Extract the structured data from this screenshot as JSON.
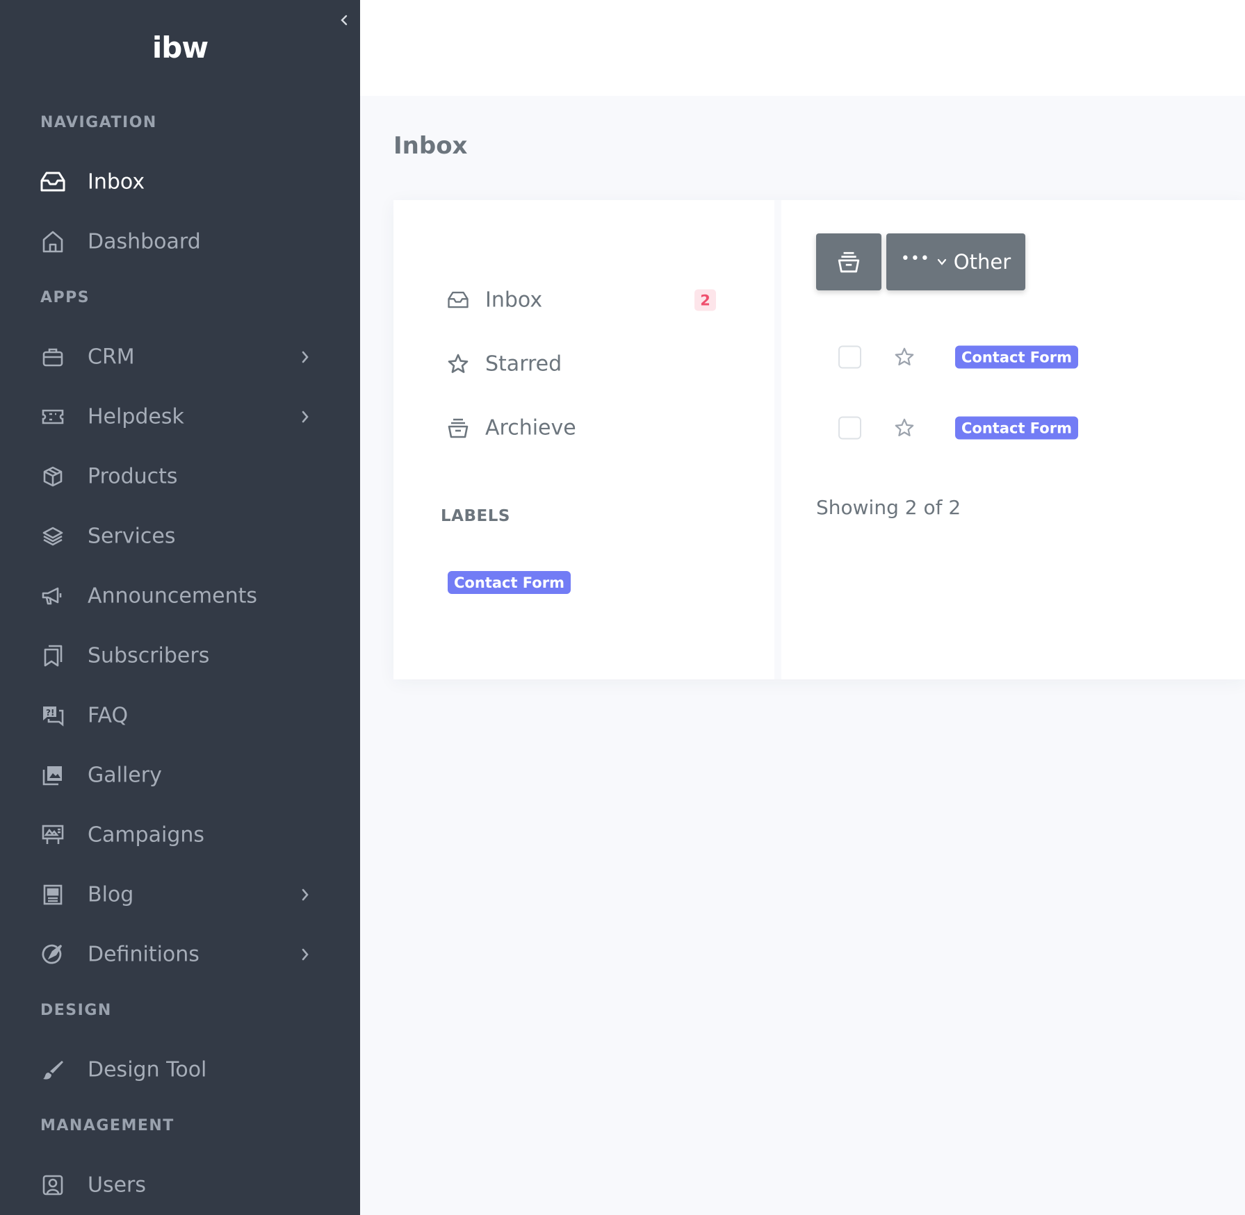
{
  "brand": {
    "logo_text": "ibw"
  },
  "sidebar": {
    "sections": [
      {
        "title": "NAVIGATION"
      },
      {
        "title": "APPS"
      },
      {
        "title": "DESIGN"
      },
      {
        "title": "MANAGEMENT"
      }
    ],
    "items": [
      {
        "label": "Inbox",
        "icon": "inbox-icon",
        "active": true
      },
      {
        "label": "Dashboard",
        "icon": "home-icon"
      },
      {
        "label": "CRM",
        "icon": "briefcase-icon",
        "has_submenu": true
      },
      {
        "label": "Helpdesk",
        "icon": "ticket-icon",
        "has_submenu": true
      },
      {
        "label": "Products",
        "icon": "box-icon"
      },
      {
        "label": "Services",
        "icon": "layers-icon"
      },
      {
        "label": "Announcements",
        "icon": "megaphone-icon"
      },
      {
        "label": "Subscribers",
        "icon": "bookmarks-icon"
      },
      {
        "label": "FAQ",
        "icon": "question-chat-icon"
      },
      {
        "label": "Gallery",
        "icon": "image-icon"
      },
      {
        "label": "Campaigns",
        "icon": "billboard-icon"
      },
      {
        "label": "Blog",
        "icon": "newspaper-icon",
        "has_submenu": true
      },
      {
        "label": "Definitions",
        "icon": "compass-icon",
        "has_submenu": true
      },
      {
        "label": "Design Tool",
        "icon": "brush-icon"
      },
      {
        "label": "Users",
        "icon": "user-square-icon"
      }
    ]
  },
  "page": {
    "title": "Inbox"
  },
  "mail": {
    "folders": [
      {
        "label": "Inbox",
        "icon": "inbox-icon",
        "badge": "2"
      },
      {
        "label": "Starred",
        "icon": "star-icon"
      },
      {
        "label": "Archieve",
        "icon": "archive-icon"
      }
    ],
    "labels_title": "LABELS",
    "labels": [
      {
        "label": "Contact Form"
      }
    ],
    "toolbar": {
      "archive_icon": "archive-icon",
      "other_label": "Other"
    },
    "messages": [
      {
        "tag": "Contact Form"
      },
      {
        "tag": "Contact Form"
      }
    ],
    "showing_text": "Showing 2 of 2"
  },
  "colors": {
    "sidebar_bg": "#333a46",
    "accent_tag": "#727cf5",
    "badge_bg": "#fde5ea",
    "badge_text": "#ef4f6d",
    "button_bg": "#6c757d"
  }
}
